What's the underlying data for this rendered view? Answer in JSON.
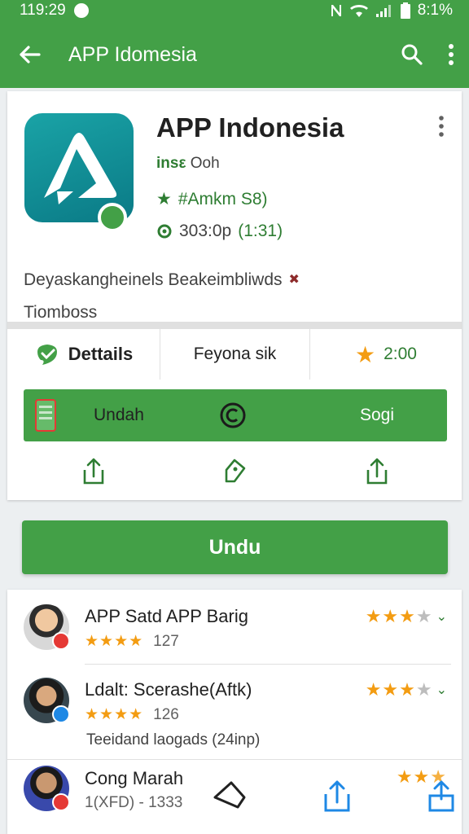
{
  "status_bar": {
    "time": "119:29",
    "battery": "8:1%"
  },
  "app_bar": {
    "title": "APP Idomesia"
  },
  "app": {
    "name": "APP Indonesia",
    "meta_line1_bold": "insε",
    "meta_line1_rest": "Ooh",
    "meta_line2": "#Amkm S8)",
    "meta_line3_a": "303:0p",
    "meta_line3_b": "(1:31)",
    "description_line1": "Deyaskangheinels Beakeimbliwds",
    "description_line2": "Tiomboss"
  },
  "stats": {
    "details_label": "Dettails",
    "middle_label": "Feyona sik",
    "rating": "2:00"
  },
  "green_bar": {
    "left_label": "Undah",
    "right_label": "Sogi"
  },
  "primary_button": {
    "label": "Undu"
  },
  "list": [
    {
      "title": "APP Satd APP Barig",
      "count": "127",
      "stars": 4,
      "badge_color": "#e53935"
    },
    {
      "title": "Ldalt: Scerashe(Aftk)",
      "count": "126",
      "stars": 4,
      "note": "Teeidand laogads (24inp)",
      "badge_color": "#1e88e5"
    },
    {
      "title": "Cong Marah",
      "sub": "1(XFD) - 1333",
      "badge_color": "#e53935"
    }
  ],
  "colors": {
    "primary": "#43a047",
    "star": "#f39c12",
    "accent_green": "#2e7d32"
  }
}
